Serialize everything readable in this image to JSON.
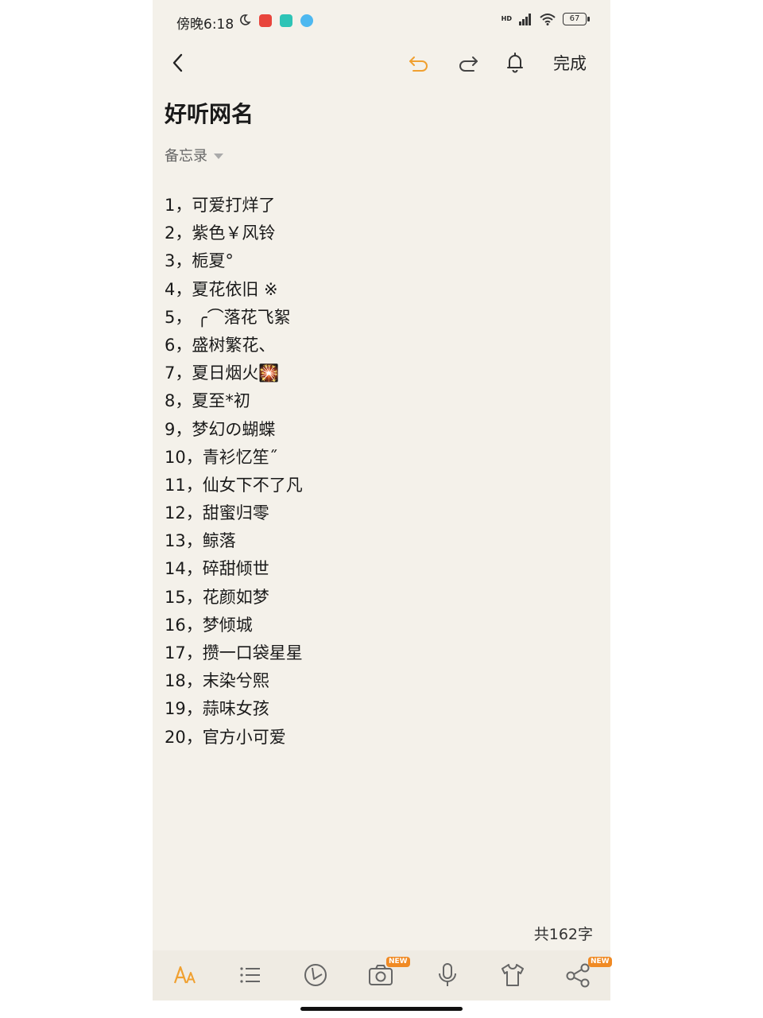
{
  "status": {
    "time": "傍晚6:18",
    "network": "HD",
    "battery": "67"
  },
  "toolbar": {
    "done_label": "完成"
  },
  "note": {
    "title": "好听网名",
    "folder": "备忘录",
    "items": [
      "1，可爱打烊了",
      "2，紫色￥风铃",
      "3，栀夏°",
      "4，夏花依旧 ※",
      "5，  ╭⌒落花飞絮",
      "6，盛树繁花、",
      "7，夏日烟火🎇",
      "8，夏至*初",
      "9，梦幻の蝴蝶",
      "10，青衫忆笙˝",
      "11，仙女下不了凡",
      "12，甜蜜归零",
      "13，鲸落",
      "14，碎甜倾世",
      "15，花颜如梦",
      "16，梦倾城",
      "17，攒一口袋星星",
      "18，末染兮熙",
      "19，蒜味女孩",
      "20，官方小可爱"
    ],
    "word_count": "共162字"
  },
  "bottom": {
    "new_badge": "NEW"
  },
  "colors": {
    "background": "#f4f1ea",
    "accent": "#f0a030",
    "badge": "#f08a24"
  }
}
